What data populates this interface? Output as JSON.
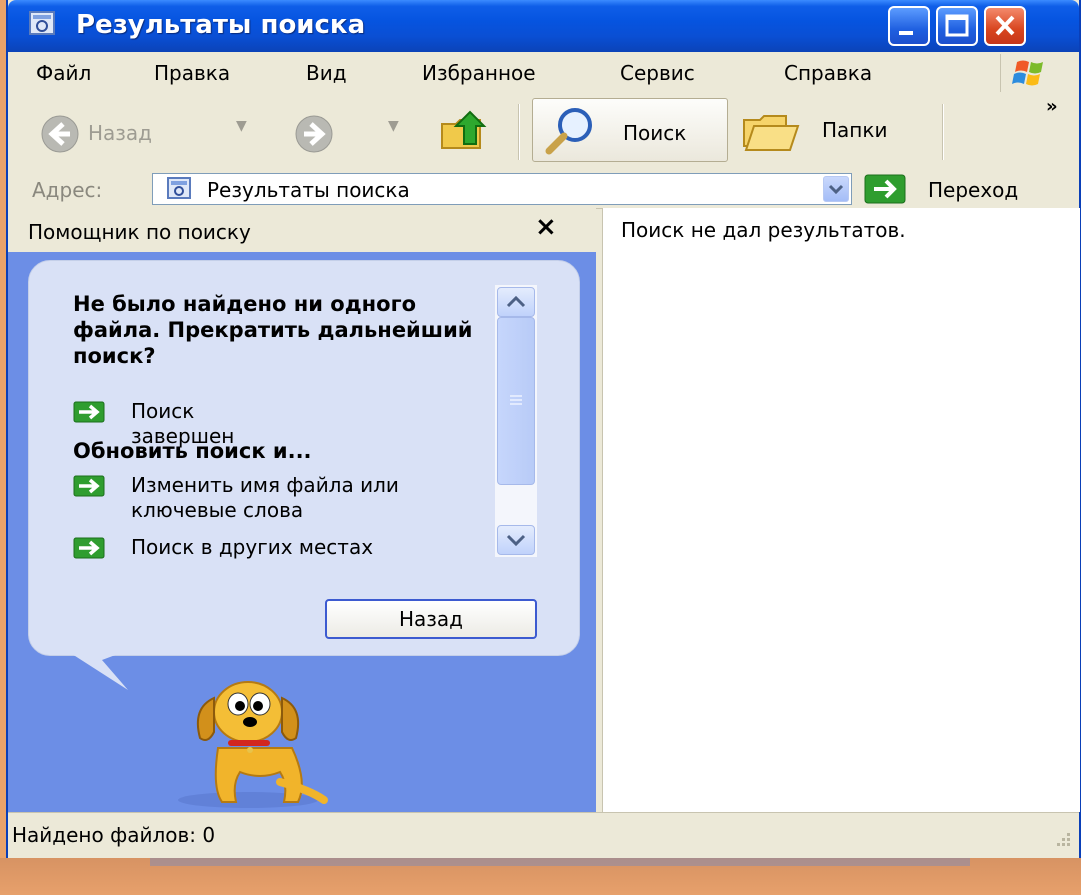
{
  "window": {
    "title": "Результаты поиска"
  },
  "menu": {
    "items": [
      "Файл",
      "Правка",
      "Вид",
      "Избранное",
      "Сервис",
      "Справка"
    ]
  },
  "toolbar": {
    "back_label": "Назад",
    "search_label": "Поиск",
    "folders_label": "Папки",
    "overflow": "»"
  },
  "address": {
    "label": "Адрес:",
    "value": "Результаты поиска",
    "go_label": "Переход"
  },
  "search_pane": {
    "header": "Помощник по поиску",
    "close": "×",
    "message": "Не было найдено ни одного файла. Прекратить дальнейший поиск?",
    "done_link": "Поиск завершен",
    "refine_heading": "Обновить поиск и...",
    "change_link": "Изменить имя файла или ключевые слова",
    "elsewhere_link": "Поиск в других местах",
    "back_button": "Назад"
  },
  "results": {
    "message": "Поиск не дал результатов."
  },
  "status": {
    "text": "Найдено файлов: 0"
  },
  "colors": {
    "title_bar": "#0654e0",
    "pane_blue": "#6c8ee6",
    "balloon": "#d9e1f6",
    "arrow_green": "#2f9d2f"
  }
}
